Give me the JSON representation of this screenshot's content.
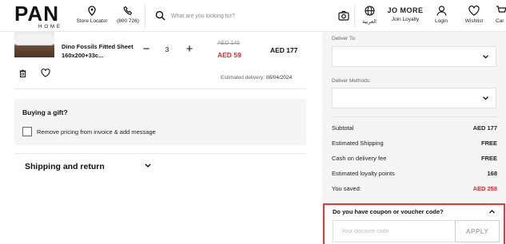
{
  "header": {
    "logo_main": "PAN",
    "logo_sub": "HOME",
    "store_locator": "Store Locator",
    "phone": "(800 726)",
    "search_placeholder": "What are you looking for?",
    "language": "العربية",
    "loyalty_logo": "JO MORE",
    "join_loyalty": "Join Loyalty",
    "login": "Login",
    "wishlist": "Wishlist",
    "cart": "Car"
  },
  "product": {
    "name": "Dino Fossils Fitted Sheet 160x200+33c...",
    "quantity": "3",
    "price_old": "AED 145",
    "price_new": "AED 59",
    "price_total": "AED 177",
    "estimated_delivery_label": "Estimated delivery:",
    "estimated_delivery_date": "08/04/2024"
  },
  "gift": {
    "title": "Buying a gift?",
    "checkbox_label": "Remove pricing from invoice & add message"
  },
  "shipping": {
    "title": "Shipping and return"
  },
  "panel": {
    "deliver_to_label": "Deliver To:",
    "deliver_methods_label": "Deliver Methods:",
    "summary": [
      {
        "label": "Subtotal",
        "value": "AED 177",
        "red": false
      },
      {
        "label": "Estimated Shipping",
        "value": "FREE",
        "red": false
      },
      {
        "label": "Cash on delivery fee",
        "value": "FREE",
        "red": false
      },
      {
        "label": "Estimated loyalty points",
        "value": "168",
        "red": false
      },
      {
        "label": "You saved:",
        "value": "AED 258",
        "red": true
      }
    ],
    "coupon_question": "Do you have coupon or voucher code?",
    "coupon_placeholder": "Your discount code",
    "apply_label": "APPLY"
  },
  "colors": {
    "accent_red": "#d32f2f",
    "highlight_border": "#e53935",
    "panel_bg": "#f5f5f5"
  }
}
